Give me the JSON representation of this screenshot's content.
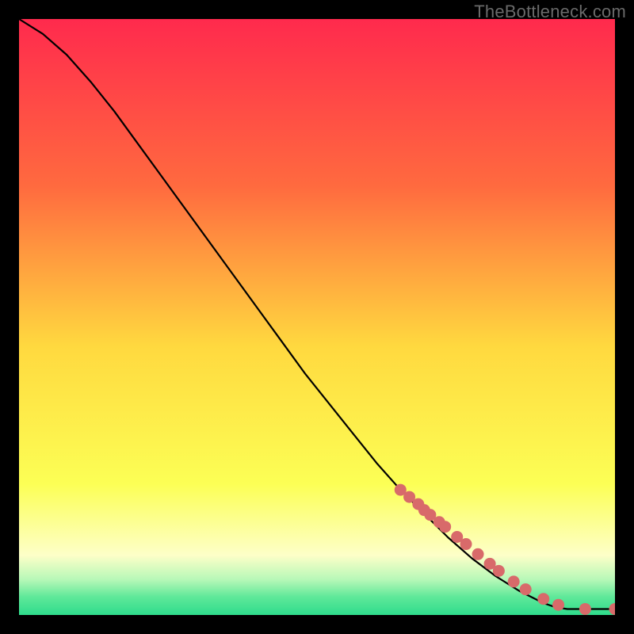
{
  "attribution": "TheBottleneck.com",
  "colors": {
    "background": "#000000",
    "gradient_top": "#ff2a4d",
    "gradient_mid_upper": "#ff8a3c",
    "gradient_mid": "#ffe63f",
    "gradient_lower": "#fcffc0",
    "gradient_green1": "#8cf2a0",
    "gradient_green2": "#2fdc8c",
    "line": "#000000",
    "marker": "#d86a6a"
  },
  "chart_data": {
    "type": "line",
    "title": "",
    "xlabel": "",
    "ylabel": "",
    "xlim": [
      0,
      100
    ],
    "ylim": [
      0,
      100
    ],
    "grid": false,
    "legend": false,
    "series": [
      {
        "name": "curve",
        "x": [
          0,
          4,
          8,
          12,
          16,
          20,
          24,
          28,
          32,
          36,
          40,
          44,
          48,
          52,
          56,
          60,
          64,
          68,
          72,
          76,
          80,
          84,
          88,
          90,
          92,
          96,
          100
        ],
        "y": [
          100,
          97.5,
          94,
          89.5,
          84.5,
          79,
          73.5,
          68,
          62.5,
          57,
          51.5,
          46,
          40.5,
          35.5,
          30.5,
          25.5,
          21,
          17,
          13,
          9.5,
          6.5,
          4,
          2,
          1.3,
          1,
          1,
          1
        ]
      }
    ],
    "markers": {
      "name": "highlighted-points",
      "color": "#d86a6a",
      "x": [
        64,
        65.5,
        67,
        68,
        69,
        70.5,
        71.5,
        73.5,
        75,
        77,
        79,
        80.5,
        83,
        85,
        88,
        90.5,
        95,
        100
      ],
      "y": [
        21,
        19.8,
        18.6,
        17.6,
        16.8,
        15.6,
        14.8,
        13.1,
        11.9,
        10.2,
        8.6,
        7.4,
        5.6,
        4.3,
        2.7,
        1.7,
        1,
        1
      ]
    }
  }
}
